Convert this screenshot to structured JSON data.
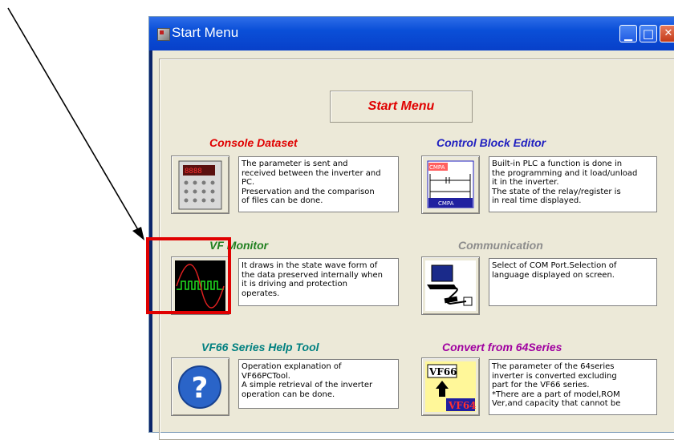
{
  "window": {
    "title": "Start Menu",
    "buttons": [
      "minimize",
      "maximize",
      "close"
    ]
  },
  "start_title": "Start Menu",
  "items": [
    {
      "heading": "Console Dataset",
      "color": "#e00000",
      "description": "The parameter is sent and\nreceived between the inverter and\nPC.\nPreservation and the comparison\nof files can be done.",
      "icon": "console-keypad-icon"
    },
    {
      "heading": "Control Block Editor",
      "color": "#2020c0",
      "description": "Built-in PLC a function is done in\nthe programming and it load/unload\nit in the inverter.\nThe state of the relay/register is\nin real time displayed.",
      "icon": "ladder-diagram-icon",
      "icon_text": "CMPA"
    },
    {
      "heading": "VF Monitor",
      "color": "#208020",
      "description": "It draws in the state wave form of\nthe data preserved internally when\nit is driving and protection\noperates.",
      "icon": "waveform-monitor-icon"
    },
    {
      "heading": "Communication",
      "color": "#8c8c8c",
      "description": "Select of COM Port.Selection of\nlanguage displayed on screen.",
      "icon": "laptop-connection-icon"
    },
    {
      "heading": "VF66 Series Help Tool",
      "color": "#008080",
      "description": "Operation explanation of\nVF66PCTool.\nA simple retrieval of the inverter\noperation can be done.",
      "icon": "help-question-icon"
    },
    {
      "heading": "Convert from 64Series",
      "color": "#a000a0",
      "description": "The parameter of the 64series\ninverter is converted excluding\npart for the VF66 series.\n*There are a part of model,ROM\nVer,and capacity that cannot be",
      "icon": "convert-vf64-to-vf66-icon",
      "icon_top": "VF66",
      "icon_bottom": "VF64"
    }
  ]
}
